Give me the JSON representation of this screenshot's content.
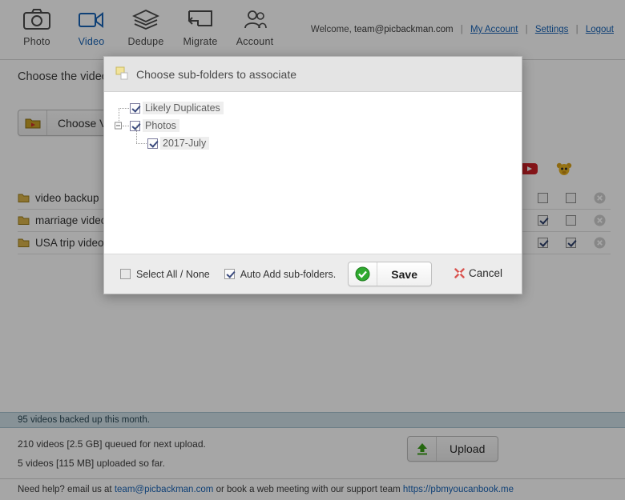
{
  "nav": {
    "items": [
      {
        "label": "Photo",
        "icon": "camera-icon",
        "active": false
      },
      {
        "label": "Video",
        "icon": "video-camera-icon",
        "active": true
      },
      {
        "label": "Dedupe",
        "icon": "layers-icon",
        "active": false
      },
      {
        "label": "Migrate",
        "icon": "migrate-arrow-icon",
        "active": false
      },
      {
        "label": "Account",
        "icon": "users-icon",
        "active": false
      }
    ]
  },
  "header": {
    "welcome_text": "Welcome,",
    "username": "team@picbackman.com",
    "links": [
      {
        "label": "My Account"
      },
      {
        "label": "Settings"
      },
      {
        "label": "Logout"
      }
    ]
  },
  "main": {
    "lead_text": "Choose the video folders you want to backup and the services to upload your videos to.",
    "choose_button": {
      "label": "Choose Videos",
      "icon": "folder-video-icon"
    },
    "services": [
      {
        "name": "google-drive-icon"
      },
      {
        "name": "youtube-icon"
      },
      {
        "name": "smugmug-icon"
      }
    ],
    "folders": [
      {
        "name": "video backup",
        "checks": [
          false,
          false,
          false
        ]
      },
      {
        "name": "marriage videos",
        "checks": [
          true,
          true,
          false
        ]
      },
      {
        "name": "USA trip videos",
        "checks": [
          true,
          true,
          true
        ]
      }
    ],
    "delete_icon": "delete-circle-icon"
  },
  "status": {
    "band_text": "95 videos backed up this month.",
    "queued_text": "210 videos [2.5 GB] queued for next upload.",
    "uploaded_text": "5 videos [115 MB] uploaded so far.",
    "upload_button": {
      "label": "Upload",
      "icon": "upload-arrow-icon"
    }
  },
  "help": {
    "prefix": "Need help? email us at",
    "email": "team@picbackman.com",
    "middle": "or book a web meeting with our support team",
    "link": "https://pbmyoucanbook.me"
  },
  "modal": {
    "title": "Choose sub-folders to associate",
    "title_icon": "folders-icon",
    "tree": [
      {
        "label": "Likely Duplicates",
        "checked": true,
        "level": 0,
        "expandable": false
      },
      {
        "label": "Photos",
        "checked": true,
        "level": 0,
        "expandable": true
      },
      {
        "label": "2017-July",
        "checked": true,
        "level": 1,
        "expandable": false
      }
    ],
    "select_all": {
      "label": "Select All / None",
      "checked": false
    },
    "auto_add": {
      "label": "Auto Add sub-folders.",
      "checked": true
    },
    "save_button": {
      "label": "Save",
      "icon": "green-check-icon"
    },
    "cancel_button": {
      "label": "Cancel",
      "icon": "red-x-icon"
    }
  },
  "colors": {
    "accent_blue": "#1763b6",
    "status_band": "#cfe0e8",
    "folder_yellow": "#c9a227",
    "save_green": "#2faa2f",
    "cancel_red": "#d9534f"
  }
}
